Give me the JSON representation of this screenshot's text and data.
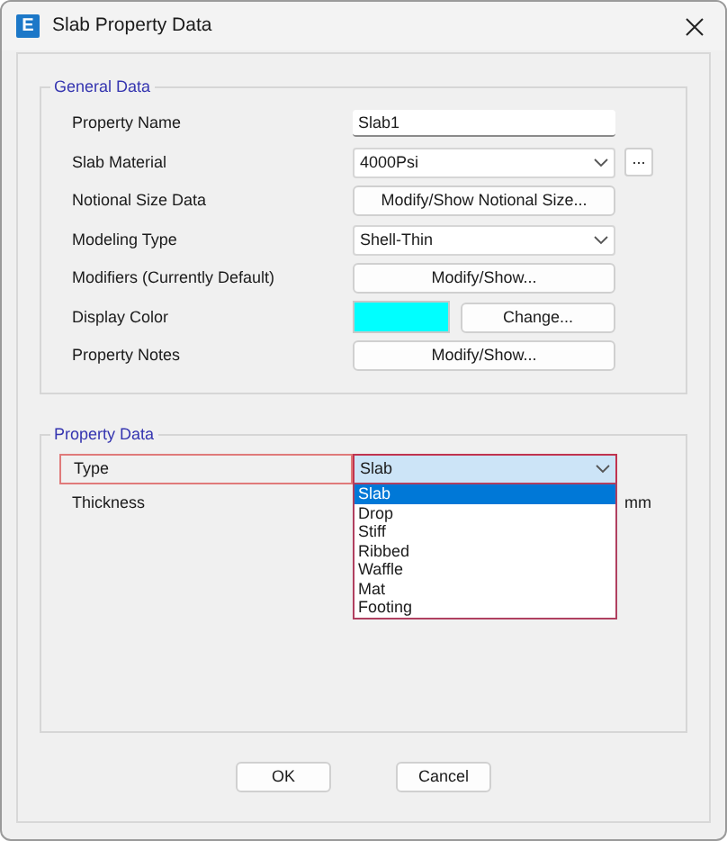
{
  "window": {
    "logo_letter": "E",
    "title": "Slab Property Data"
  },
  "general_data": {
    "title": "General Data",
    "rows": [
      {
        "kind": "text",
        "label": "Property Name",
        "value": "Slab1"
      },
      {
        "kind": "select",
        "label": "Slab Material",
        "value": "4000Psi",
        "extra_button": "..."
      },
      {
        "kind": "button",
        "label": "Notional Size Data",
        "button": "Modify/Show Notional Size..."
      },
      {
        "kind": "select",
        "label": "Modeling Type",
        "value": "Shell-Thin"
      },
      {
        "kind": "button",
        "label": "Modifiers (Currently Default)",
        "button": "Modify/Show..."
      },
      {
        "kind": "color",
        "label": "Display Color",
        "color": "#00ffff",
        "button": "Change..."
      },
      {
        "kind": "button",
        "label": "Property Notes",
        "button": "Modify/Show..."
      }
    ]
  },
  "property_data": {
    "title": "Property Data",
    "type": {
      "label": "Type",
      "value": "Slab",
      "highlighted": true,
      "expanded": true,
      "options": [
        {
          "label": "Slab",
          "selected": true
        },
        {
          "label": "Drop",
          "selected": false
        },
        {
          "label": "Stiff",
          "selected": false
        },
        {
          "label": "Ribbed",
          "selected": false
        },
        {
          "label": "Waffle",
          "selected": false
        },
        {
          "label": "Mat",
          "selected": false
        },
        {
          "label": "Footing",
          "selected": false
        }
      ]
    },
    "thickness": {
      "label": "Thickness",
      "unit": "mm"
    }
  },
  "buttons": [
    "OK",
    "Cancel"
  ]
}
